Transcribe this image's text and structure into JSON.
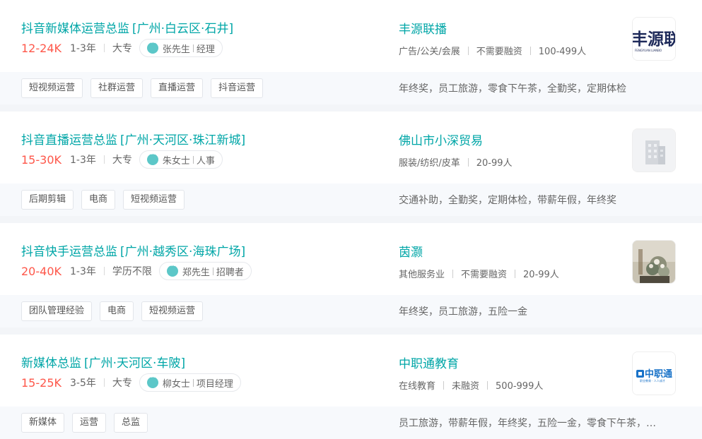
{
  "jobs": [
    {
      "title": "抖音新媒体运营总监",
      "area": "[广州·白云区·石井]",
      "salary": "12-24K",
      "experience": "1-3年",
      "education": "大专",
      "recruiter_name": "张先生",
      "recruiter_role": "经理",
      "skills": [
        "短视频运营",
        "社群运营",
        "直播运营",
        "抖音运营"
      ],
      "company": "丰源联播",
      "industry": "广告/公关/会展",
      "financing": "不需要融资",
      "size": "100-499人",
      "welfare": "年终奖，员工旅游，零食下午茶，全勤奖，定期体检",
      "logo_text": "丰源联",
      "logo_subtext": "FENGYUAN LIANBO"
    },
    {
      "title": "抖音直播运营总监",
      "area": "[广州·天河区·珠江新城]",
      "salary": "15-30K",
      "experience": "1-3年",
      "education": "大专",
      "recruiter_name": "朱女士",
      "recruiter_role": "人事",
      "skills": [
        "后期剪辑",
        "电商",
        "短视频运营"
      ],
      "company": "佛山市小深贸易",
      "industry": "服装/纺织/皮革",
      "size": "20-99人",
      "welfare": "交通补助，全勤奖，定期体检，带薪年假，年终奖"
    },
    {
      "title": "抖音快手运营总监",
      "area": "[广州·越秀区·海珠广场]",
      "salary": "20-40K",
      "experience": "1-3年",
      "education": "学历不限",
      "recruiter_name": "郑先生",
      "recruiter_role": "招聘者",
      "skills": [
        "团队管理经验",
        "电商",
        "短视频运营"
      ],
      "company": "茵灏",
      "industry": "其他服务业",
      "financing": "不需要融资",
      "size": "20-99人",
      "welfare": "年终奖，员工旅游，五险一金"
    },
    {
      "title": "新媒体总监",
      "area": "[广州·天河区·车陂]",
      "salary": "15-25K",
      "experience": "3-5年",
      "education": "大专",
      "recruiter_name": "柳女士",
      "recruiter_role": "项目经理",
      "skills": [
        "新媒体",
        "运营",
        "总监"
      ],
      "company": "中职通教育",
      "industry": "在线教育",
      "financing": "未融资",
      "size": "500-999人",
      "welfare": "员工旅游，带薪年假，年终奖，五险一金，零食下午茶，…",
      "logo_text": "中职通",
      "logo_subtext": "职业教育 · 人人成才"
    }
  ],
  "colors": {
    "accent": "#00a6a7",
    "salary": "#fe574a",
    "chat": "#5cc7c8"
  }
}
